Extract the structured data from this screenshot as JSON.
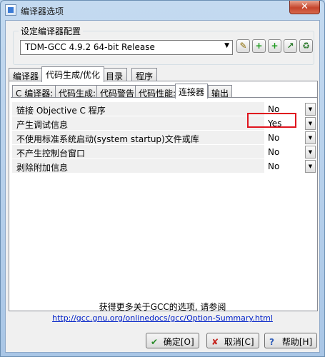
{
  "window": {
    "title": "编译器选项",
    "close_label": "✕"
  },
  "compiler_config": {
    "label": "设定编译器配置",
    "selected": "TDM-GCC 4.9.2 64-bit Release",
    "dropdown_arrow": "▼"
  },
  "toolbar": {
    "icons": [
      "edit-config-icon",
      "add-config-icon",
      "copy-config-icon",
      "rename-config-icon",
      "delete-config-icon"
    ],
    "glyphs": [
      "✎",
      "+",
      "+",
      "↗",
      "♻"
    ]
  },
  "tabs": [
    "编译器",
    "代码生成/优化",
    "目录",
    "程序"
  ],
  "subtabs": [
    "C 编译器:",
    "代码生成:",
    "代码警告",
    "代码性能:",
    "连接器",
    "输出"
  ],
  "options": [
    {
      "name": "链接 Objective C 程序",
      "value": "No"
    },
    {
      "name": "产生调试信息",
      "value": "Yes"
    },
    {
      "name": "不使用标准系统启动(system startup)文件或库",
      "value": "No"
    },
    {
      "name": "不产生控制台窗口",
      "value": "No"
    },
    {
      "name": "剥除附加信息",
      "value": "No"
    }
  ],
  "option_dropdown_glyph": "▼",
  "info": {
    "text": "获得更多关于GCC的选项, 请参阅",
    "link": "http://gcc.gnu.org/onlinedocs/gcc/Option-Summary.html"
  },
  "buttons": {
    "ok": "确定[O]",
    "cancel": "取消[C]",
    "help": "帮助[H]",
    "ok_glyph": "✔",
    "cancel_glyph": "✘",
    "help_glyph": "?"
  },
  "colors": {
    "highlight": "#e0141e",
    "link": "#0020c8"
  }
}
